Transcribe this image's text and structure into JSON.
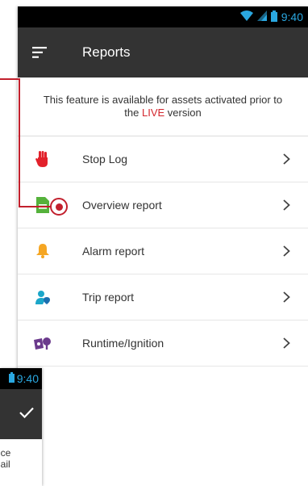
{
  "status_bar": {
    "time": "9:40",
    "icons": [
      "wifi-icon",
      "signal-icon",
      "battery-icon"
    ]
  },
  "toolbar": {
    "title": "Reports",
    "menu_icon": "sort-menu-icon"
  },
  "notice": {
    "text_before": "This feature is available for assets activated prior to the ",
    "highlight": "LIVE",
    "text_after": " version",
    "highlight_color": "#d3262d"
  },
  "reports": [
    {
      "label": "Stop Log",
      "icon": "hand-stop-icon",
      "color": "#e2212b"
    },
    {
      "label": "Overview report",
      "icon": "document-icon",
      "color": "#55b23b"
    },
    {
      "label": "Alarm report",
      "icon": "bell-icon",
      "color": "#f5a623"
    },
    {
      "label": "Trip report",
      "icon": "person-pin-icon",
      "color": "#1ba6c9"
    },
    {
      "label": "Runtime/Ignition",
      "icon": "runtime-icon",
      "color": "#6b3a8c"
    }
  ],
  "second_screen": {
    "time": "9:40",
    "confirm_icon": "check-icon",
    "text_line1": "nce",
    "text_line2": "nail"
  },
  "annotation_color": "#c2202d"
}
